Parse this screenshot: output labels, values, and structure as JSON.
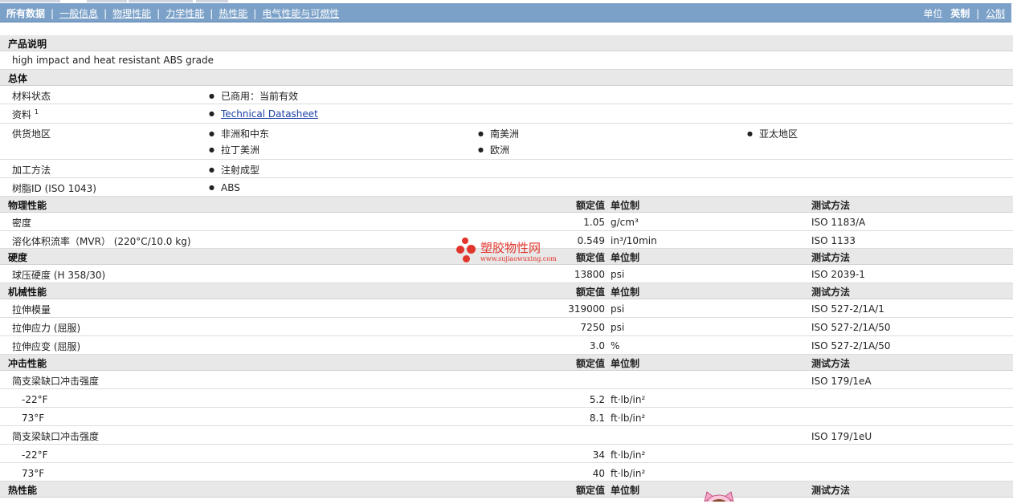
{
  "nav": {
    "items": [
      "所有数据",
      "一般信息",
      "物理性能",
      "力学性能",
      "热性能",
      "电气性能与可燃性"
    ],
    "unit_label": "单位",
    "unit_imperial": "英制",
    "unit_separator": "|",
    "unit_metric": "公制"
  },
  "sections": {
    "description": {
      "title": "产品说明",
      "text": "high impact and heat resistant ABS grade"
    },
    "general": {
      "title": "总体",
      "status_label": "材料状态",
      "status_value": "已商用：当前有效",
      "docs_label": "资料",
      "docs_sup": "1",
      "docs_link": "Technical Datasheet",
      "regions_label": "供货地区",
      "regions": [
        "非洲和中东",
        "南美洲",
        "亚太地区",
        "拉丁美洲",
        "欧洲"
      ],
      "process_label": "加工方法",
      "process_value": "注射成型",
      "resin_label": "树脂ID (ISO 1043)",
      "resin_value": "ABS"
    },
    "headers": {
      "value": "额定值",
      "unit": "单位制",
      "method": "测试方法"
    },
    "physical": {
      "title": "物理性能",
      "rows": [
        {
          "label": "密度",
          "value": "1.05",
          "unit": "g/cm³",
          "method": "ISO 1183/A"
        },
        {
          "label": "溶化体积流率（MVR） (220°C/10.0 kg)",
          "value": "0.549",
          "unit": "in³/10min",
          "method": "ISO 1133"
        }
      ]
    },
    "hardness": {
      "title": "硬度",
      "rows": [
        {
          "label": "球压硬度 (H 358/30)",
          "value": "13800",
          "unit": "psi",
          "method": "ISO 2039-1"
        }
      ]
    },
    "mechanical": {
      "title": "机械性能",
      "rows": [
        {
          "label": "拉伸模量",
          "value": "319000",
          "unit": "psi",
          "method": "ISO 527-2/1A/1"
        },
        {
          "label": "拉伸应力 (屈服)",
          "value": "7250",
          "unit": "psi",
          "method": "ISO 527-2/1A/50"
        },
        {
          "label": "拉伸应变 (屈服)",
          "value": "3.0",
          "unit": "%",
          "method": "ISO 527-2/1A/50"
        }
      ]
    },
    "impact": {
      "title": "冲击性能",
      "notched_label": "简支梁缺口冲击强度",
      "notched_method": "ISO 179/1eA",
      "notched_rows": [
        {
          "label": "-22°F",
          "value": "5.2",
          "unit": "ft·lb/in²"
        },
        {
          "label": "73°F",
          "value": "8.1",
          "unit": "ft·lb/in²"
        }
      ],
      "unnotched_label": "简支梁缺口冲击强度",
      "unnotched_method": "ISO 179/1eU",
      "unnotched_rows": [
        {
          "label": "-22°F",
          "value": "34",
          "unit": "ft·lb/in²"
        },
        {
          "label": "73°F",
          "value": "40",
          "unit": "ft·lb/in²"
        }
      ]
    },
    "thermal": {
      "title": "热性能"
    }
  },
  "watermark": {
    "title": "塑胶物性网",
    "url": "www.sujiaowuxing.com",
    "color": "#e1342b"
  },
  "colors": {
    "nav_bg": "#7ba1c8",
    "section_bg": "#e8e8e8",
    "link": "#1a3fa8"
  }
}
